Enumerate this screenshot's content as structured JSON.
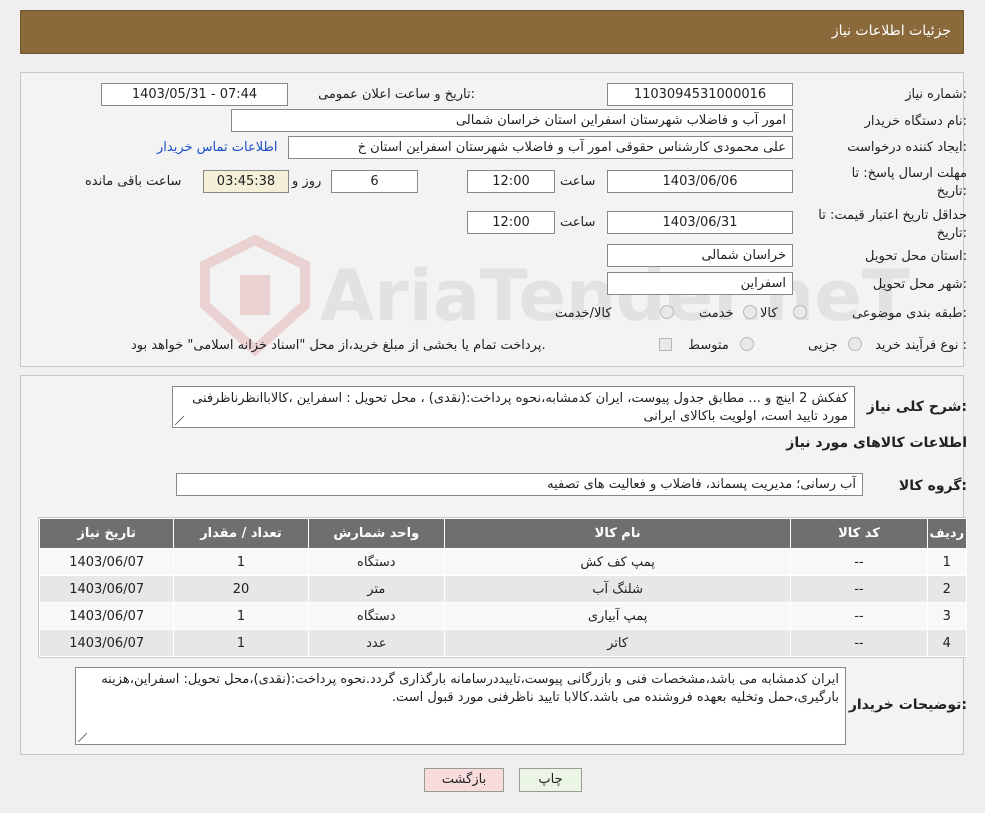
{
  "header": {
    "title": "جزئیات اطلاعات نیاز"
  },
  "form": {
    "need_number_label": "شماره نیاز:",
    "need_number": "1103094531000016",
    "announce_label": "تاریخ و ساعت اعلان عمومی:",
    "announce_value": "1403/05/31 - 07:44",
    "buyer_label": "نام دستگاه خریدار:",
    "buyer_value": "امور آب و فاضلاب شهرستان اسفراین استان خراسان شمالی",
    "creator_label": "ایجاد کننده درخواست:",
    "creator_value": "علی  محمودی  کارشناس حقوقی امور آب و فاضلاب شهرستان اسفراین استان خ",
    "contact_link": "اطلاعات تماس خریدار",
    "deadline_label_1": "مهلت ارسال پاسخ: تا",
    "deadline_label_2": "تاریخ:",
    "deadline_date": "1403/06/06",
    "time_label": "ساعت",
    "deadline_time": "12:00",
    "days_value": "6",
    "days_label": "روز و",
    "remaining_time": "03:45:38",
    "remaining_label": "ساعت باقی مانده",
    "validity_label_1": "حداقل تاریخ اعتبار قیمت: تا",
    "validity_label_2": "تاریخ:",
    "validity_date": "1403/06/31",
    "validity_time": "12:00",
    "province_label": "استان محل تحویل:",
    "province_value": "خراسان شمالی",
    "city_label": "شهر محل تحویل:",
    "city_value": "اسفراین",
    "category_label": "طبقه بندی موضوعی:",
    "category_options": [
      "کالا",
      "خدمت",
      "کالا/خدمت"
    ],
    "process_label": "نوع فرآیند خرید :",
    "process_options": [
      "جزیی",
      "متوسط"
    ],
    "payment_note": "پرداخت تمام یا بخشی از مبلغ خرید،از محل \"اسناد خزانه اسلامی\" خواهد بود."
  },
  "details": {
    "summary_label": "شرح کلی نیاز:",
    "summary_text": "کفکش 2 اینچ  و ... مطابق جدول پیوست، ایران کدمشابه،نحوه پرداخت:(نقدی) ، محل تحویل : اسفراین ،کالاباانظرناظرفنی مورد تایید است، اولویت باکالای ایرانی",
    "goods_info_title": "اطلاعات کالاهای مورد نیاز",
    "group_label": "گروه کالا:",
    "group_value": "آب رسانی؛ مدیریت پسماند، فاضلاب و فعالیت های تصفیه",
    "table_headers": [
      "ردیف",
      "کد کالا",
      "نام کالا",
      "واحد شمارش",
      "تعداد / مقدار",
      "تاریخ نیاز"
    ],
    "rows": [
      [
        "1",
        "--",
        "پمپ کف کش",
        "دستگاه",
        "1",
        "1403/06/07"
      ],
      [
        "2",
        "--",
        "شلنگ آب",
        "متر",
        "20",
        "1403/06/07"
      ],
      [
        "3",
        "--",
        "پمپ آبیاری",
        "دستگاه",
        "1",
        "1403/06/07"
      ],
      [
        "4",
        "--",
        "کاتر",
        "عدد",
        "1",
        "1403/06/07"
      ]
    ],
    "buyer_notes_label": "توضیحات خریدار:",
    "buyer_notes_text": "ایران کدمشابه می باشد،مشخصات فنی و بازرگانی پیوست،تاییددرسامانه بارگذاری گردد.نحوه پرداخت:(نقدی)،محل تحویل: اسفراین،هزینه بارگیری،حمل وتخلیه بعهده فروشنده می باشد.کالابا تایید ناظرفنی مورد قبول است."
  },
  "buttons": {
    "print": "چاپ",
    "back": "بازگشت"
  },
  "watermark": {
    "text": "AriaTender.neT"
  }
}
